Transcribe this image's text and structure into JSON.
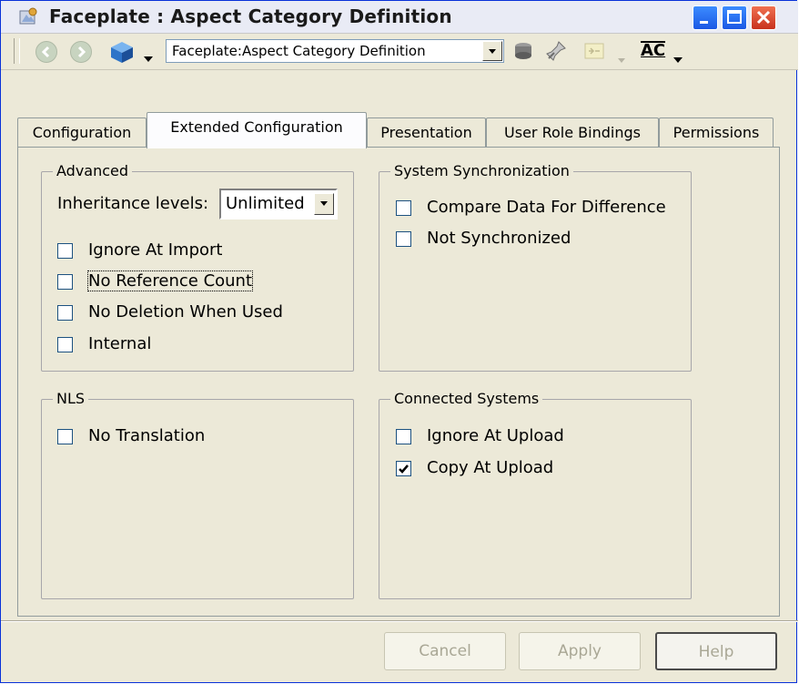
{
  "window": {
    "title": "Faceplate : Aspect Category Definition"
  },
  "toolbar": {
    "path_value": "Faceplate:Aspect Category Definition",
    "ac_label": "AC"
  },
  "tabs": [
    {
      "label": "Configuration"
    },
    {
      "label": "Extended Configuration",
      "active": true
    },
    {
      "label": "Presentation"
    },
    {
      "label": "User Role Bindings"
    },
    {
      "label": "Permissions"
    }
  ],
  "groups": {
    "advanced": {
      "title": "Advanced",
      "inheritance_label": "Inheritance levels:",
      "inheritance_value": "Unlimited",
      "options": [
        {
          "label": "Ignore At Import",
          "checked": false
        },
        {
          "label": "No Reference Count",
          "checked": false,
          "focused": true
        },
        {
          "label": "No Deletion When Used",
          "checked": false
        },
        {
          "label": "Internal",
          "checked": false
        }
      ]
    },
    "sync": {
      "title": "System Synchronization",
      "options": [
        {
          "label": "Compare Data For Difference",
          "checked": false
        },
        {
          "label": "Not Synchronized",
          "checked": false
        }
      ]
    },
    "nls": {
      "title": "NLS",
      "options": [
        {
          "label": "No Translation",
          "checked": false
        }
      ]
    },
    "connected": {
      "title": "Connected Systems",
      "options": [
        {
          "label": "Ignore At Upload",
          "checked": false
        },
        {
          "label": "Copy At Upload",
          "checked": true
        }
      ]
    }
  },
  "buttons": {
    "cancel": "Cancel",
    "apply": "Apply",
    "help": "Help"
  },
  "icons": {
    "title": "faceplate-icon",
    "back": "back-arrow-icon",
    "forward": "forward-arrow-icon",
    "object": "object-cube-icon",
    "stack": "stack-icon",
    "pin": "pin-icon",
    "view": "view-icon"
  }
}
